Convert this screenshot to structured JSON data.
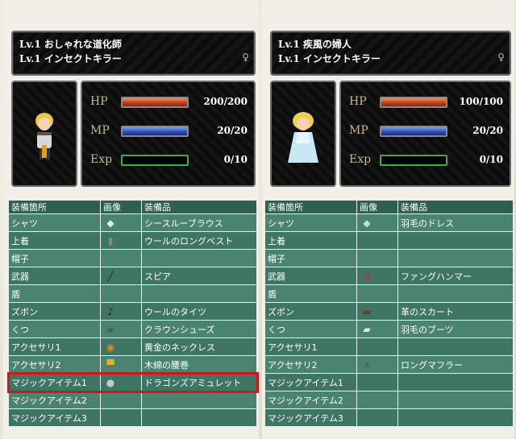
{
  "characters": [
    {
      "name_line": "Lv.1 おしゃれな道化師",
      "job_line": "Lv.1 インセクトキラー",
      "sex_symbol": "♀",
      "stats": [
        {
          "label": "HP",
          "value": "200/200",
          "fill": 1.0
        },
        {
          "label": "MP",
          "value": "20/20",
          "fill": 1.0
        },
        {
          "label": "Exp",
          "value": "0/10",
          "fill": 0.0
        }
      ],
      "headers": [
        "装備箇所",
        "画像",
        "装備品"
      ],
      "equipment": [
        {
          "slot": "シャツ",
          "icon": "shirt-icon",
          "glyph": "◆",
          "color": "#e8e8e8",
          "item": "シースルーブラウス"
        },
        {
          "slot": "上着",
          "icon": "vest-icon",
          "glyph": "▮",
          "color": "#8a8a8a",
          "item": "ウールのロングベスト"
        },
        {
          "slot": "帽子",
          "icon": "",
          "glyph": "",
          "color": "",
          "item": ""
        },
        {
          "slot": "武器",
          "icon": "spear-icon",
          "glyph": "╱",
          "color": "#2a2a2a",
          "item": "スピア"
        },
        {
          "slot": "盾",
          "icon": "",
          "glyph": "",
          "color": "",
          "item": ""
        },
        {
          "slot": "ズボン",
          "icon": "tights-icon",
          "glyph": "♪",
          "color": "#222",
          "item": "ウールのタイツ"
        },
        {
          "slot": "くつ",
          "icon": "shoes-icon",
          "glyph": "▰",
          "color": "#4a5a70",
          "item": "クラウンシューズ"
        },
        {
          "slot": "アクセサリ1",
          "icon": "necklace-icon",
          "glyph": "◉",
          "color": "#e08a20",
          "item": "黄金のネックレス"
        },
        {
          "slot": "アクセサリ2",
          "icon": "sash-icon",
          "glyph": "▀",
          "color": "#e0b030",
          "item": "木綿の腰巻"
        },
        {
          "slot": "マジックアイテム1",
          "icon": "amulet-icon",
          "glyph": "●",
          "color": "#c8c8d0",
          "item": "ドラゴンズアミュレット"
        },
        {
          "slot": "マジックアイテム2",
          "icon": "",
          "glyph": "",
          "color": "",
          "item": ""
        },
        {
          "slot": "マジックアイテム3",
          "icon": "",
          "glyph": "",
          "color": "",
          "item": ""
        }
      ]
    },
    {
      "name_line": "Lv.1 疾風の婦人",
      "job_line": "Lv.1 インセクトキラー",
      "sex_symbol": "♀",
      "stats": [
        {
          "label": "HP",
          "value": "100/100",
          "fill": 1.0
        },
        {
          "label": "MP",
          "value": "20/20",
          "fill": 1.0
        },
        {
          "label": "Exp",
          "value": "0/10",
          "fill": 0.0
        }
      ],
      "headers": [
        "装備箇所",
        "画像",
        "装備品"
      ],
      "equipment": [
        {
          "slot": "シャツ",
          "icon": "dress-icon",
          "glyph": "◆",
          "color": "#b8dcf0",
          "item": "羽毛のドレス"
        },
        {
          "slot": "上着",
          "icon": "",
          "glyph": "",
          "color": "",
          "item": ""
        },
        {
          "slot": "帽子",
          "icon": "",
          "glyph": "",
          "color": "",
          "item": ""
        },
        {
          "slot": "武器",
          "icon": "hammer-icon",
          "glyph": "⚒",
          "color": "#c03030",
          "item": "ファングハンマー"
        },
        {
          "slot": "盾",
          "icon": "",
          "glyph": "",
          "color": "",
          "item": ""
        },
        {
          "slot": "ズボン",
          "icon": "skirt-icon",
          "glyph": "▬",
          "color": "#6a4020",
          "item": "革のスカート"
        },
        {
          "slot": "くつ",
          "icon": "boots-icon",
          "glyph": "▰",
          "color": "#e8e8e8",
          "item": "羽毛のブーツ"
        },
        {
          "slot": "アクセサリ1",
          "icon": "",
          "glyph": "",
          "color": "",
          "item": ""
        },
        {
          "slot": "アクセサリ2",
          "icon": "scarf-icon",
          "glyph": "∧",
          "color": "#555",
          "item": "ロングマフラー"
        },
        {
          "slot": "マジックアイテム1",
          "icon": "",
          "glyph": "",
          "color": "",
          "item": ""
        },
        {
          "slot": "マジックアイテム2",
          "icon": "",
          "glyph": "",
          "color": "",
          "item": ""
        },
        {
          "slot": "マジックアイテム3",
          "icon": "",
          "glyph": "",
          "color": "",
          "item": ""
        }
      ]
    }
  ],
  "highlight": {
    "character": 0,
    "row": 9,
    "color": "#d4141c"
  }
}
